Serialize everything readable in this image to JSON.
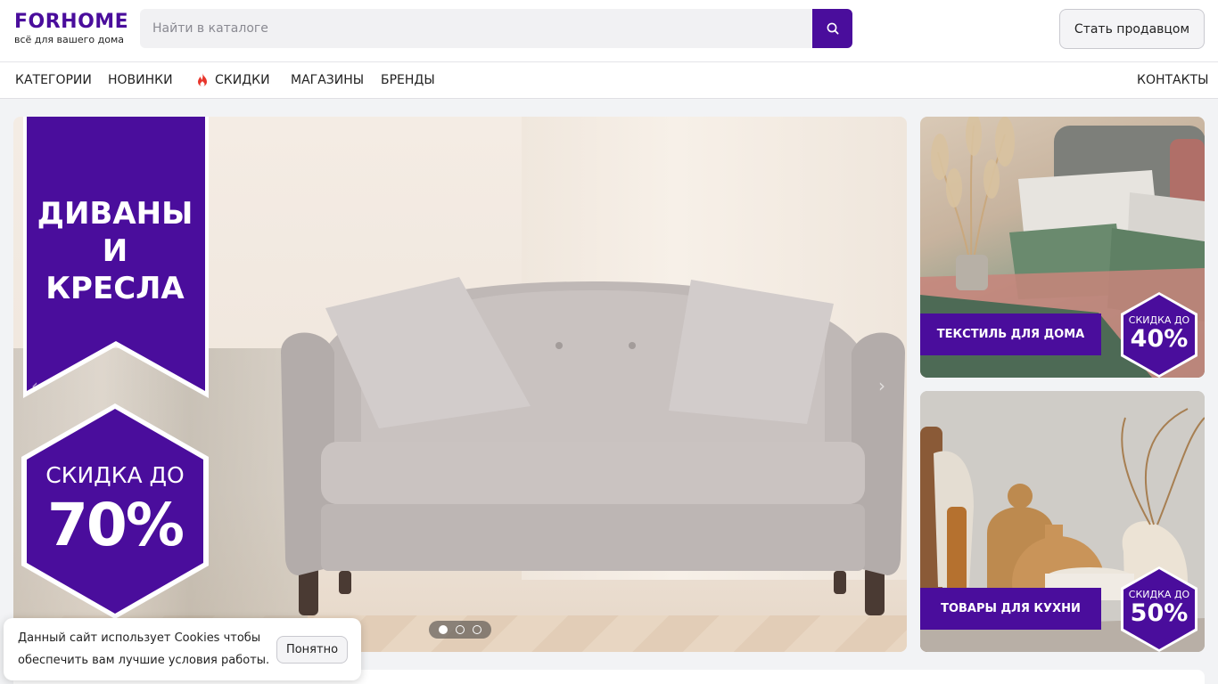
{
  "header": {
    "logo_title": "FORHOME",
    "logo_subtitle": "всё для вашего дома",
    "search_placeholder": "Найти в каталоге",
    "seller_button": "Стать продавцом"
  },
  "nav": {
    "items": [
      {
        "label": "КАТЕГОРИИ"
      },
      {
        "label": "НОВИНКИ"
      },
      {
        "label": "СКИДКИ",
        "icon": "fire-icon"
      },
      {
        "label": "МАГАЗИНЫ"
      },
      {
        "label": "БРЕНДЫ"
      }
    ],
    "contacts": "КОНТАКТЫ"
  },
  "hero": {
    "title_line1": "ДИВАНЫ",
    "title_line2": "И КРЕСЛА",
    "discount_label": "СКИДКА ДО",
    "discount_value": "70%",
    "slides_total": 3,
    "active_slide": 1
  },
  "side_banners": [
    {
      "label": "ТЕКСТИЛЬ ДЛЯ ДОМА",
      "discount_label": "СКИДКА ДО",
      "discount_value": "40%"
    },
    {
      "label": "ТОВАРЫ ДЛЯ КУХНИ",
      "discount_label": "СКИДКА ДО",
      "discount_value": "50%"
    }
  ],
  "cookie": {
    "text": "Данный сайт использует Cookies чтобы обеспечить вам лучшие условия работы.",
    "button": "Понятно"
  },
  "colors": {
    "brand": "#4a0d9c",
    "fire": "#e8352b"
  }
}
